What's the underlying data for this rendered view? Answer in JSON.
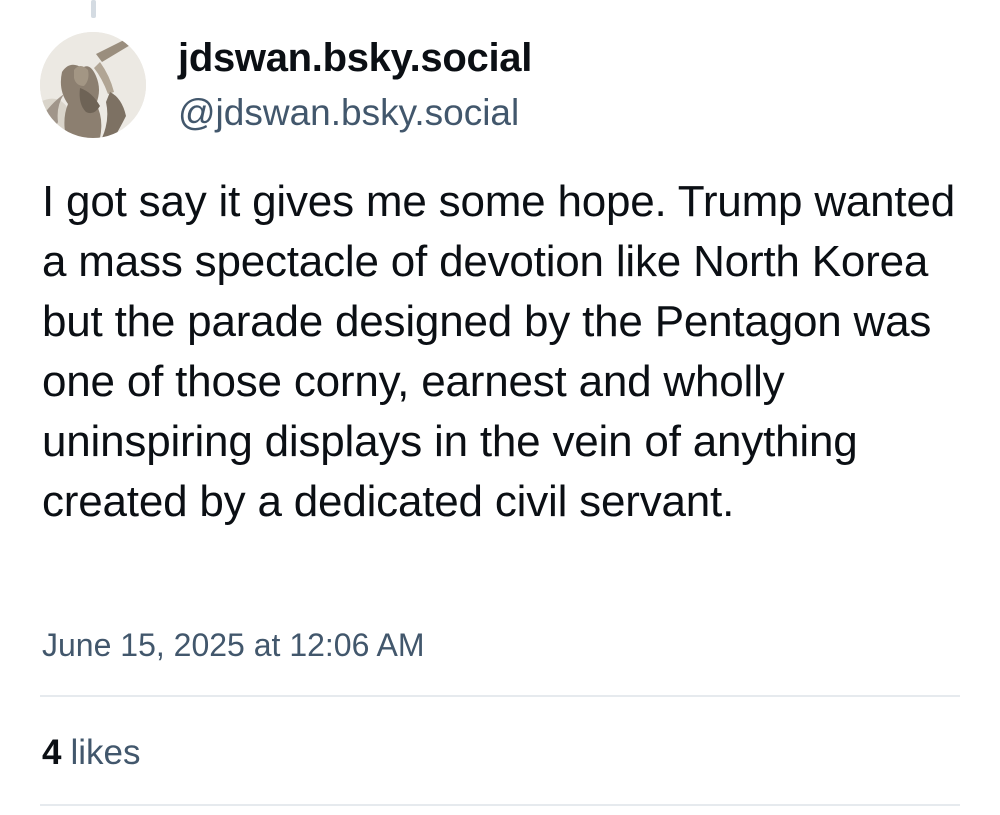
{
  "post": {
    "author": {
      "display_name": "jdswan.bsky.social",
      "handle": "@jdswan.bsky.social",
      "avatar": "statue-photo-avatar"
    },
    "text": "I got say it gives me some hope. Trump wanted a mass spectacle of devotion like North Korea but the parade designed by the Pentagon was one of those corny, earnest and wholly uninspiring displays in the vein of anything created by a dedicated civil servant.",
    "timestamp": "June 15, 2025 at 12:06 AM",
    "likes": {
      "count": "4",
      "label": "likes"
    }
  },
  "colors": {
    "text_primary": "#0b0f14",
    "text_secondary": "#42576c",
    "divider": "#e6eaee",
    "thread_line": "#d4dbe2"
  }
}
